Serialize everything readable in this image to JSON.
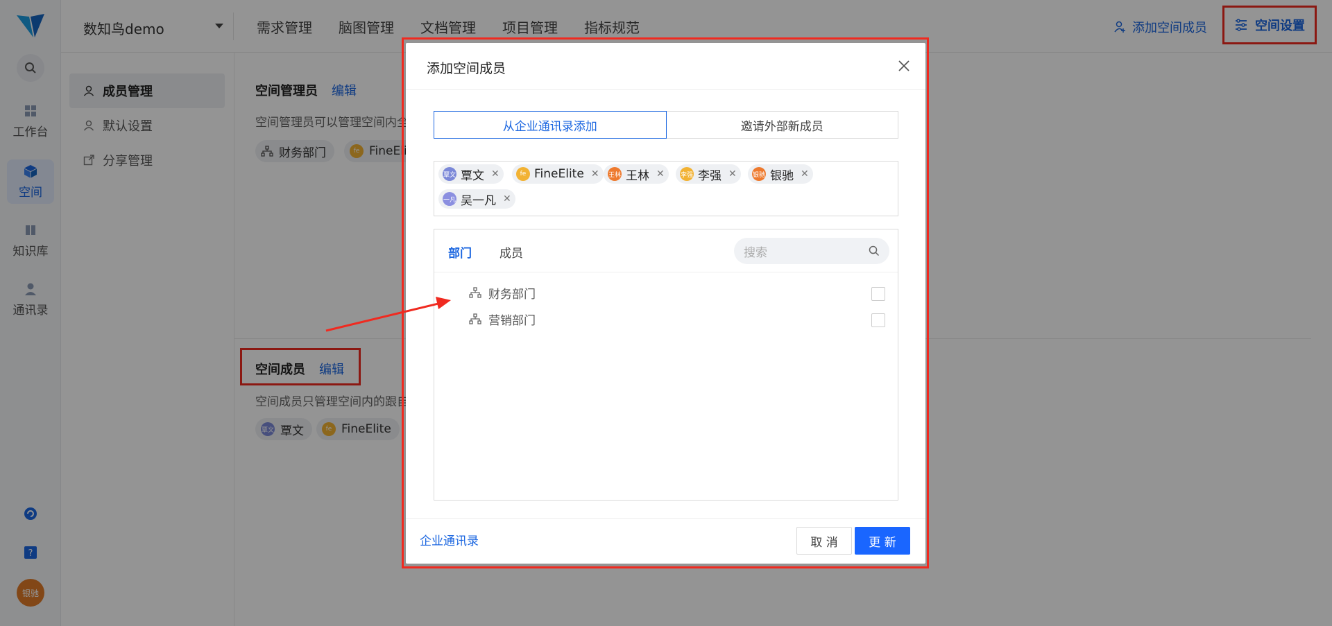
{
  "app": {
    "space_name": "数知鸟demo",
    "top_tabs": [
      "需求管理",
      "脑图管理",
      "文档管理",
      "项目管理",
      "指标规范"
    ],
    "add_member": "添加空间成员",
    "space_settings": "空间设置"
  },
  "left_nav": [
    {
      "label": "工作台",
      "icon": "dashboard-icon"
    },
    {
      "label": "空间",
      "icon": "cube-icon"
    },
    {
      "label": "知识库",
      "icon": "book-icon"
    },
    {
      "label": "通讯录",
      "icon": "contacts-icon"
    }
  ],
  "user_avatar": "银驰",
  "subnav": [
    "成员管理",
    "默认设置",
    "分享管理"
  ],
  "content": {
    "admins_title": "空间管理员",
    "admins_edit": "编辑",
    "admins_desc": "空间管理员可以管理空间内全",
    "admins_chips": [
      "财务部门",
      "FineElite"
    ],
    "members_title": "空间成员",
    "members_edit": "编辑",
    "members_desc": "空间成员只管理空间内的跟自",
    "members_chips": [
      "覃文",
      "FineElite"
    ]
  },
  "dialog": {
    "title": "添加空间成员",
    "seg_tabs": [
      "从企业通讯录添加",
      "邀请外部新成员"
    ],
    "selected": [
      {
        "name": "覃文",
        "avatar": "覃文",
        "color": "#7b88d8"
      },
      {
        "name": "FineElite",
        "avatar": "fe",
        "color": "#f2b233"
      },
      {
        "name": "王林",
        "avatar": "王林",
        "color": "#ee7a2e"
      },
      {
        "name": "李强",
        "avatar": "李强",
        "color": "#f2b233"
      },
      {
        "name": "银驰",
        "avatar": "银驰",
        "color": "#ee7a2e"
      },
      {
        "name": "吴一凡",
        "avatar": "一凡",
        "color": "#8b8fe0"
      }
    ],
    "picker_tabs": [
      "部门",
      "成员"
    ],
    "search_placeholder": "搜索",
    "departments": [
      "财务部门",
      "营销部门"
    ],
    "footer_link": "企业通讯录",
    "cancel": "取 消",
    "update": "更 新"
  }
}
